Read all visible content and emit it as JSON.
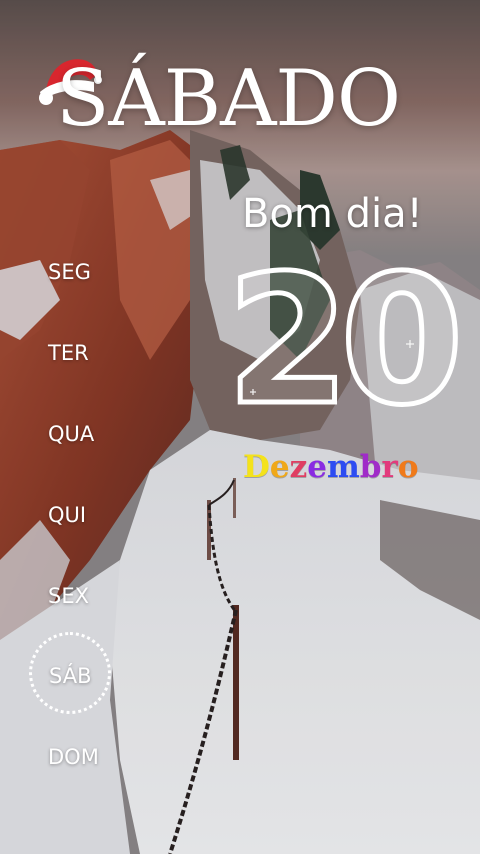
{
  "day_title": "SÁBADO",
  "greeting": "Bom dia!",
  "date": {
    "day": "20",
    "month": "Dezembro"
  },
  "weekdays": [
    "SEG",
    "TER",
    "QUA",
    "QUI",
    "SEX",
    "SÁB",
    "DOM"
  ],
  "active_weekday_index": 5,
  "icons": [
    "santa-hat-icon"
  ],
  "colors": {
    "text": "#ffffff",
    "month_gradient": [
      "#f4e21b",
      "#f0a818",
      "#e03e62",
      "#8a2be2",
      "#2d4cf2",
      "#a02bc8",
      "#e23a7c",
      "#f07a1a"
    ]
  }
}
